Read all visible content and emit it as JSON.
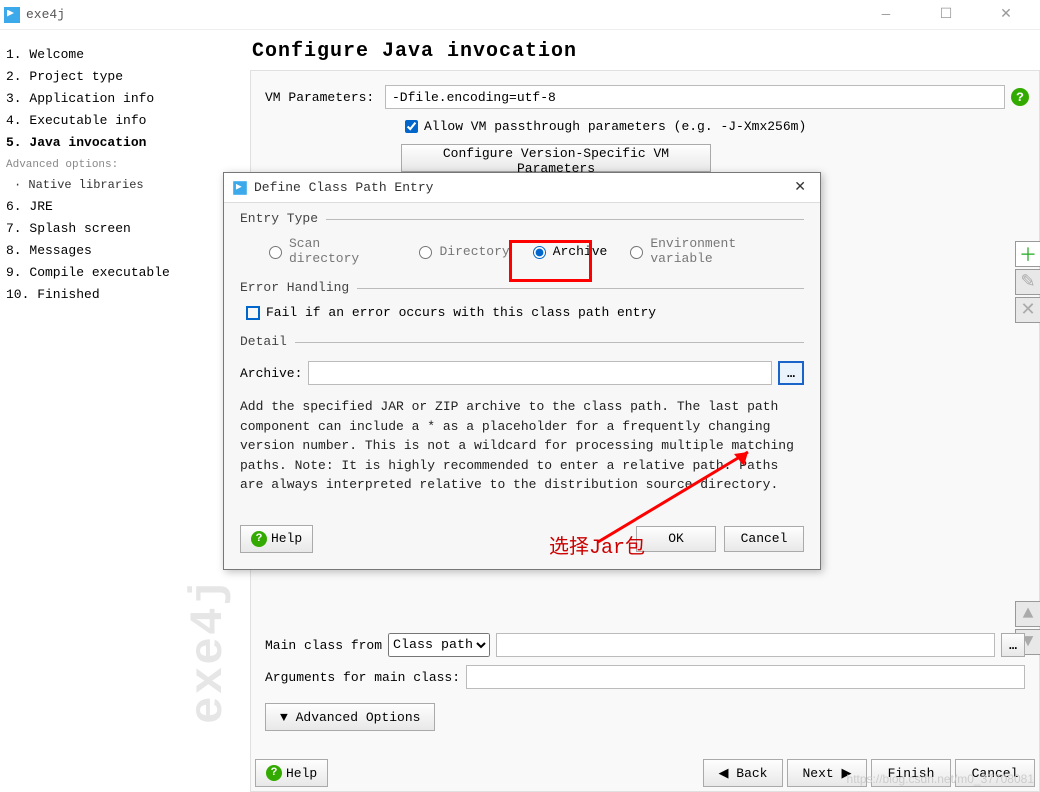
{
  "window": {
    "title": "exe4j"
  },
  "sidebar_steps": [
    "1. Welcome",
    "2. Project type",
    "3. Application info",
    "4. Executable info",
    "5. Java invocation",
    "6. JRE",
    "7. Splash screen",
    "8. Messages",
    "9. Compile executable",
    "10. Finished"
  ],
  "sidebar": {
    "advanced_label": "Advanced options:",
    "native_lib": "· Native libraries"
  },
  "page": {
    "title": "Configure Java invocation",
    "vm_label": "VM Parameters:",
    "vm_value": "-Dfile.encoding=utf-8",
    "allow_passthrough": "Allow VM passthrough parameters (e.g. -J-Xmx256m)",
    "version_btn": "Configure Version-Specific VM Parameters",
    "main_class_label": "Main class from",
    "main_class_select": "Class path",
    "arguments_label": "Arguments for main class:",
    "advanced_btn": "▼ Advanced Options"
  },
  "dialog": {
    "title": "Define Class Path Entry",
    "entry_type": "Entry Type",
    "radios": {
      "scan": "Scan directory",
      "dir": "Directory",
      "archive": "Archive",
      "env": "Environment variable"
    },
    "error_handling": "Error Handling",
    "fail_label": "Fail if an error occurs with this class path entry",
    "detail": "Detail",
    "archive_label": "Archive:",
    "detail_text": "Add the specified JAR or ZIP archive to the class path. The last path component can include a * as a placeholder for a frequently changing version number. This is not a wildcard for processing multiple matching paths. Note: It is highly recommended to enter a relative path. Paths are always interpreted relative to the distribution source directory.",
    "help": "Help",
    "ok": "OK",
    "cancel": "Cancel"
  },
  "footer": {
    "help": "Help",
    "back": "◀  Back",
    "next": "Next  ▶",
    "finish": "Finish",
    "cancel": "Cancel"
  },
  "annotation": {
    "text": "选择Jar包"
  },
  "watermark": {
    "text": "exe4j",
    "url": "https://blog.csdn.net/m0_37708081"
  }
}
